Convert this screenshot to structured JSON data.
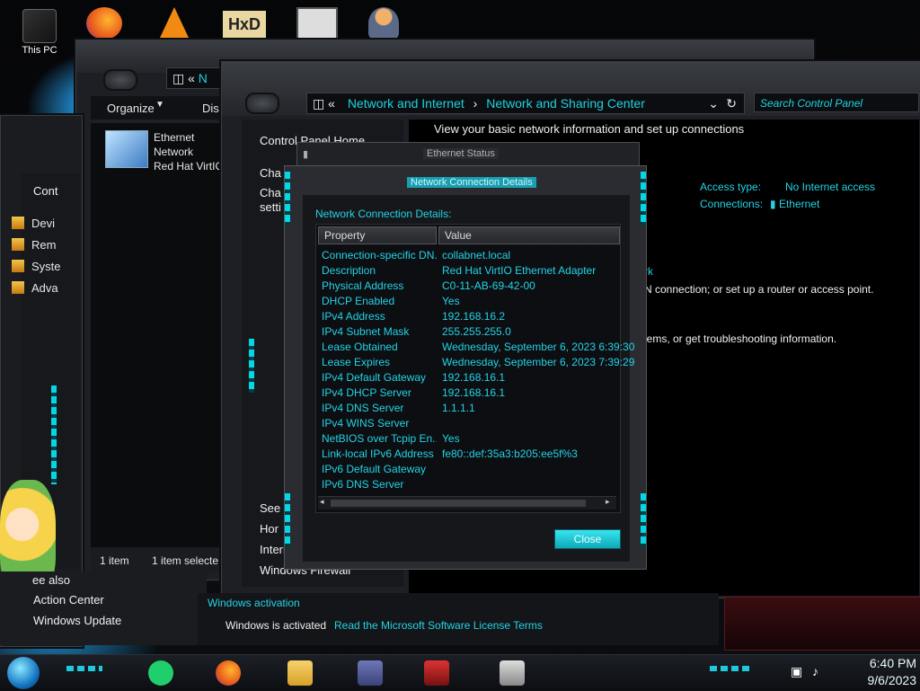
{
  "desktop": {
    "this_pc": "This PC"
  },
  "explorer_back": {
    "address_fragment": "N",
    "toolbar": {
      "organize": "Organize",
      "disable": "Disab"
    },
    "item": {
      "name": "Ethernet",
      "type": "Network",
      "adapter": "Red Hat VirtIC"
    },
    "status": {
      "count": "1 item",
      "selected": "1 item selecte"
    }
  },
  "left_window": {
    "nav_title": "Cont",
    "items": [
      "Devi",
      "Rem",
      "Syste",
      "Adva"
    ],
    "see_also": "ee also",
    "links": [
      "Action Center",
      "Windows Update"
    ]
  },
  "main_window": {
    "breadcrumb": {
      "sep": "«",
      "part1": "Network and Internet",
      "part2": "Network and Sharing Center"
    },
    "search_placeholder": "Search Control Panel",
    "heading": "View your basic network information and set up connections",
    "side_links": [
      "Control Panel Home",
      "Cha",
      "Cha",
      "setti"
    ],
    "see_links": [
      "See",
      "Hor",
      "Interr",
      "Windows Firewall"
    ],
    "access_type_label": "Access type:",
    "access_type_value": "No Internet access",
    "connections_label": "Connections:",
    "connections_value": "Ethernet",
    "text_fragment_1": "rk",
    "text_fragment_2": "N connection; or set up a router or access point.",
    "text_fragment_3": "lems, or get troubleshooting information.",
    "activation_title": "Windows activation",
    "activation_status": "Windows is activated",
    "activation_link": "Read the Microsoft Software License Terms"
  },
  "ethernet_status": {
    "title": "Ethernet Status"
  },
  "details_dialog": {
    "title": "Network Connection Details",
    "label": "Network Connection Details:",
    "col_property": "Property",
    "col_value": "Value",
    "rows": [
      {
        "property": "Connection-specific DN...",
        "value": "collabnet.local"
      },
      {
        "property": "Description",
        "value": "Red Hat VirtIO Ethernet Adapter"
      },
      {
        "property": "Physical Address",
        "value": "C0-11-AB-69-42-00"
      },
      {
        "property": "DHCP Enabled",
        "value": "Yes"
      },
      {
        "property": "IPv4 Address",
        "value": "192.168.16.2"
      },
      {
        "property": "IPv4 Subnet Mask",
        "value": "255.255.255.0"
      },
      {
        "property": "Lease Obtained",
        "value": "Wednesday, September 6, 2023 6:39:30"
      },
      {
        "property": "Lease Expires",
        "value": "Wednesday, September 6, 2023 7:39:29"
      },
      {
        "property": "IPv4 Default Gateway",
        "value": "192.168.16.1"
      },
      {
        "property": "IPv4 DHCP Server",
        "value": "192.168.16.1"
      },
      {
        "property": "IPv4 DNS Server",
        "value": "1.1.1.1"
      },
      {
        "property": "IPv4 WINS Server",
        "value": ""
      },
      {
        "property": "NetBIOS over Tcpip En...",
        "value": "Yes"
      },
      {
        "property": "Link-local IPv6 Address",
        "value": "fe80::def:35a3:b205:ee5f%3"
      },
      {
        "property": "IPv6 Default Gateway",
        "value": ""
      },
      {
        "property": "IPv6 DNS Server",
        "value": ""
      }
    ],
    "close": "Close"
  },
  "taskbar": {
    "time": "6:40 PM",
    "date": "9/6/2023"
  },
  "colors": {
    "accent": "#22d3e6",
    "window_bg": "#1d1f24",
    "text": "#f0f0f0"
  }
}
